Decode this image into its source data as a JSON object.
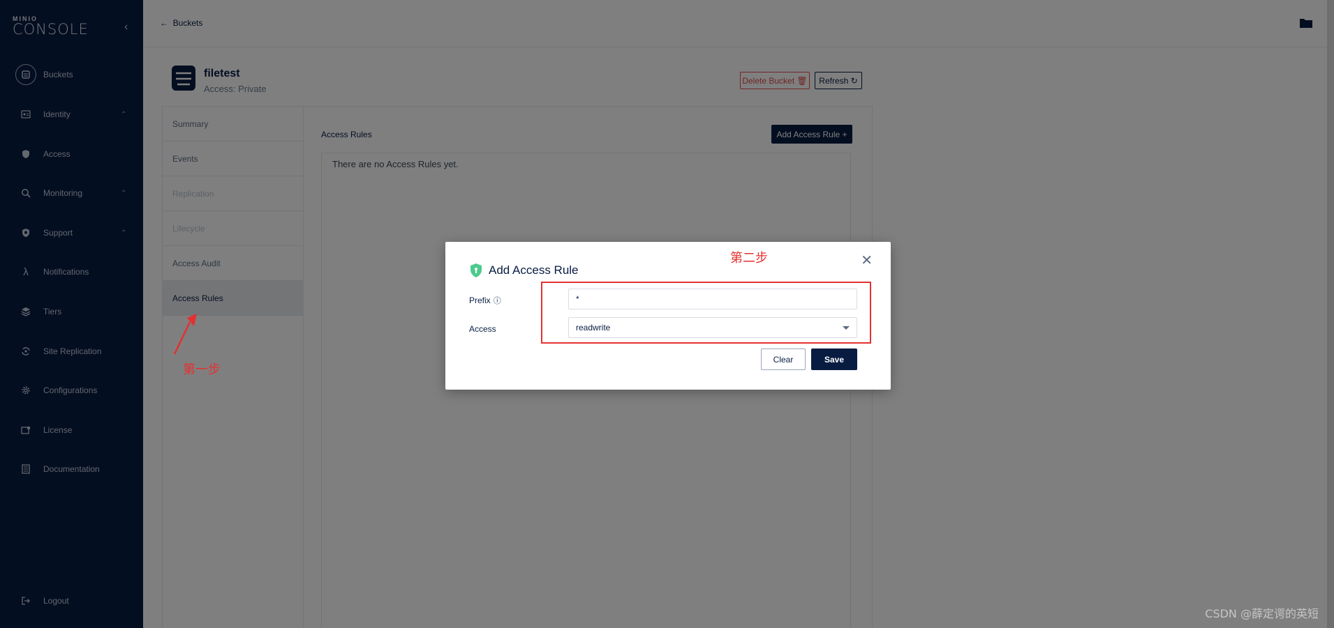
{
  "sidebar": {
    "logo_small": "MINIO",
    "logo_main": "CONSOLE",
    "items": [
      {
        "label": "Buckets"
      },
      {
        "label": "Identity"
      },
      {
        "label": "Access"
      },
      {
        "label": "Monitoring"
      },
      {
        "label": "Support"
      },
      {
        "label": "Notifications"
      },
      {
        "label": "Tiers"
      },
      {
        "label": "Site Replication"
      },
      {
        "label": "Configurations"
      },
      {
        "label": "License"
      },
      {
        "label": "Documentation"
      }
    ],
    "logout": "Logout"
  },
  "topbar": {
    "back_label": "Buckets"
  },
  "bucket": {
    "name": "filetest",
    "access": "Access: Private",
    "delete_label": "Delete Bucket",
    "refresh_label": "Refresh"
  },
  "tabs": [
    {
      "label": "Summary"
    },
    {
      "label": "Events"
    },
    {
      "label": "Replication"
    },
    {
      "label": "Lifecycle"
    },
    {
      "label": "Access Audit"
    },
    {
      "label": "Access Rules"
    }
  ],
  "access_rules": {
    "title": "Access Rules",
    "add_label": "Add Access Rule",
    "empty_text": "There are no Access Rules yet."
  },
  "modal": {
    "title": "Add Access Rule",
    "prefix_label": "Prefix",
    "prefix_value": "*",
    "access_label": "Access",
    "access_value": "readwrite",
    "clear_label": "Clear",
    "save_label": "Save"
  },
  "annotations": {
    "step1": "第一步",
    "step2": "第二步",
    "watermark": "CSDN @薛定谔的英短"
  },
  "colors": {
    "navy": "#081c42",
    "danger": "#e24a4a",
    "annotation": "#e53030",
    "shield": "#4ccb8d"
  }
}
